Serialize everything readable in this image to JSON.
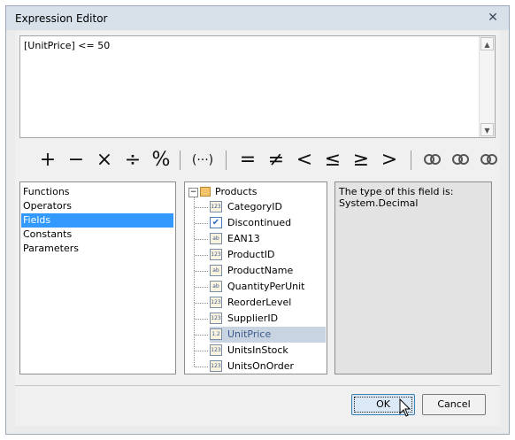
{
  "window": {
    "title": "Expression Editor",
    "close_glyph": "✕"
  },
  "editor": {
    "expression": "[UnitPrice] <= 50"
  },
  "operators": [
    "+",
    "−",
    "×",
    "÷",
    "%",
    "(···)",
    "=",
    "≠",
    "<",
    "≤",
    "≥",
    ">"
  ],
  "categories": {
    "items": [
      "Functions",
      "Operators",
      "Fields",
      "Constants",
      "Parameters"
    ],
    "selected": "Fields"
  },
  "tree": {
    "root": "Products",
    "fields": [
      {
        "name": "CategoryID",
        "icon": "123"
      },
      {
        "name": "Discontinued",
        "icon": "✔"
      },
      {
        "name": "EAN13",
        "icon": "ab"
      },
      {
        "name": "ProductID",
        "icon": "123"
      },
      {
        "name": "ProductName",
        "icon": "ab"
      },
      {
        "name": "QuantityPerUnit",
        "icon": "ab"
      },
      {
        "name": "ReorderLevel",
        "icon": "123"
      },
      {
        "name": "SupplierID",
        "icon": "123"
      },
      {
        "name": "UnitPrice",
        "icon": "1.2"
      },
      {
        "name": "UnitsInStock",
        "icon": "123"
      },
      {
        "name": "UnitsOnOrder",
        "icon": "123"
      }
    ],
    "selected": "UnitPrice"
  },
  "description": {
    "line1": "The type of this field is:",
    "line2": "System.Decimal"
  },
  "buttons": {
    "ok": "OK",
    "cancel": "Cancel"
  }
}
